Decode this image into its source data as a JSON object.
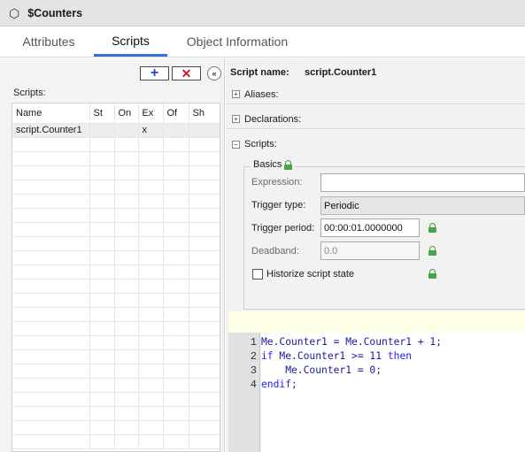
{
  "window": {
    "title": "$Counters",
    "icon": "hexagon-icon"
  },
  "tabs": [
    "Attributes",
    "Scripts",
    "Object Information"
  ],
  "active_tab": "Scripts",
  "left_panel": {
    "add_icon": "plus-icon",
    "delete_icon": "x-icon",
    "collapse_icon": "double-chevron-left-icon",
    "scripts_label": "Scripts:",
    "columns": [
      "Name",
      "St",
      "On",
      "Ex",
      "Of",
      "Sh"
    ],
    "rows": [
      [
        "script.Counter1",
        "",
        "",
        "x",
        "",
        ""
      ]
    ]
  },
  "script_name": {
    "label": "Script name:",
    "value": "script.Counter1"
  },
  "sections": [
    {
      "label": "Aliases:",
      "state": "+"
    },
    {
      "label": "Declarations:",
      "state": "+"
    },
    {
      "label": "Scripts:",
      "state": "−"
    }
  ],
  "basics": {
    "legend": "Basics",
    "expression_label": "Expression:",
    "expression_value": "",
    "trigger_type_label": "Trigger type:",
    "trigger_type_value": "Periodic",
    "trigger_period_label": "Trigger period:",
    "trigger_period_value": "00:00:01.0000000",
    "deadband_label": "Deadband:",
    "deadband_value": "0.0",
    "historize_label": "Historize script state",
    "historize_checked": false
  },
  "code": {
    "line_numbers": [
      "1",
      "2",
      "3",
      "4"
    ],
    "lines": [
      [
        {
          "t": "Me.Counter1 = Me.Counter1 + 1;",
          "k": false
        }
      ],
      [
        {
          "t": "if",
          "k": true
        },
        {
          "t": " Me.Counter1 >= 11 ",
          "k": false
        },
        {
          "t": "then",
          "k": true
        }
      ],
      [
        {
          "t": "    Me.Counter1 = 0;",
          "k": false
        }
      ],
      [
        {
          "t": "endif",
          "k": true
        },
        {
          "t": ";",
          "k": false
        }
      ]
    ]
  },
  "colors": {
    "accent": "#3a6fd8",
    "keyword": "#2020ff",
    "code_text": "#1a1a9a",
    "lock": "#49a349"
  }
}
